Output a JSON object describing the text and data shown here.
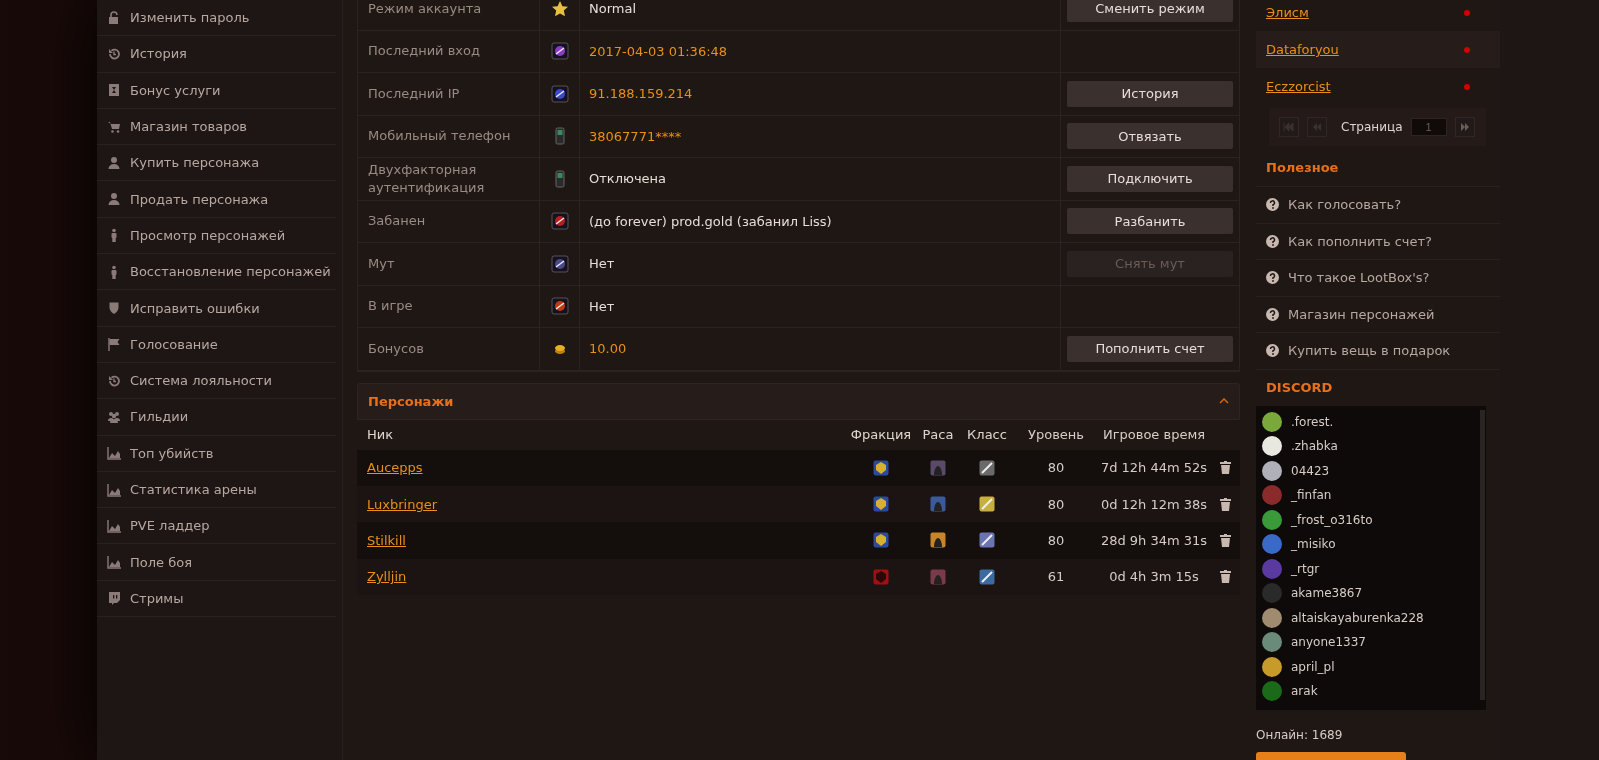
{
  "sidebar": {
    "items": [
      {
        "label": "Изменить пароль"
      },
      {
        "label": "История"
      },
      {
        "label": "Бонус услуги"
      },
      {
        "label": "Магазин товаров"
      },
      {
        "label": "Купить персонажа"
      },
      {
        "label": "Продать персонажа"
      },
      {
        "label": "Просмотр персонажей"
      },
      {
        "label": "Восстановление персонажей"
      },
      {
        "label": "Исправить ошибки"
      },
      {
        "label": "Голосование"
      },
      {
        "label": "Система лояльности"
      },
      {
        "label": "Гильдии"
      },
      {
        "label": "Топ убийств"
      },
      {
        "label": "Статистика арены"
      },
      {
        "label": "PVE ладдер"
      },
      {
        "label": "Поле боя"
      },
      {
        "label": "Стримы"
      }
    ]
  },
  "account": {
    "rows": [
      {
        "label": "Режим аккаунта",
        "value": "Normal",
        "accent": false,
        "action": {
          "label": "Сменить режим",
          "disabled": false
        }
      },
      {
        "label": "Последний вход",
        "value": "2017-04-03 01:36:48",
        "accent": true
      },
      {
        "label": "Последний IP",
        "value": "91.188.159.214",
        "accent": true,
        "action": {
          "label": "История",
          "disabled": false
        }
      },
      {
        "label": "Мобильный телефон",
        "value": "38067771****",
        "accent": true,
        "action": {
          "label": "Отвязать",
          "disabled": false
        }
      },
      {
        "label": "Двухфакторная аутентификация",
        "value": "Отключена",
        "accent": false,
        "action": {
          "label": "Подключить",
          "disabled": false
        }
      },
      {
        "label": "Забанен",
        "value": "(до forever) prod.gold (забанил Liss)",
        "accent": false,
        "action": {
          "label": "Разбанить",
          "disabled": false
        }
      },
      {
        "label": "Мут",
        "value": "Нет",
        "accent": false,
        "action": {
          "label": "Снять мут",
          "disabled": true
        }
      },
      {
        "label": "В игре",
        "value": "Нет",
        "accent": false
      },
      {
        "label": "Бонусов",
        "value": "10.00",
        "accent": true,
        "action": {
          "label": "Пополнить счет",
          "disabled": false
        }
      }
    ]
  },
  "characters": {
    "title": "Персонажи",
    "expanded": true,
    "columns": [
      "Ник",
      "Фракция",
      "Раса",
      "Класс",
      "Уровень",
      "Игровое время"
    ],
    "rows": [
      {
        "name": "Aucepps",
        "kind": "alliance",
        "level": "80",
        "time": "7d 12h 44m 52s"
      },
      {
        "name": "Luxbringer",
        "kind": "alliance",
        "level": "80",
        "time": "0d 12h 12m 38s"
      },
      {
        "name": "Stilkill",
        "kind": "alliance",
        "level": "80",
        "time": "28d 9h 34m 31s"
      },
      {
        "name": "Zylljin",
        "kind": "horde",
        "level": "61",
        "time": "0d 4h 3m 15s"
      }
    ]
  },
  "friends": [
    {
      "name": "Элисм",
      "online": false
    },
    {
      "name": "Dataforyou",
      "online": false
    },
    {
      "name": "Eczzorcist",
      "online": false
    }
  ],
  "pager": {
    "label": "Страница",
    "placeholder": "1"
  },
  "useful": {
    "title": "Полезное",
    "items": [
      "Как голосовать?",
      "Как пополнить счет?",
      "Что такое LootBox's?",
      "Магазин персонажей",
      "Купить вещь в подарок"
    ]
  },
  "discord": {
    "title": "DISCORD",
    "members": [
      {
        "name": ".forest."
      },
      {
        "name": ".zhabka"
      },
      {
        "name": "04423"
      },
      {
        "name": "_finfan"
      },
      {
        "name": "_frost_o316to"
      },
      {
        "name": "_misiko"
      },
      {
        "name": "_rtgr"
      },
      {
        "name": "akame3867"
      },
      {
        "name": "altaiskayaburenka228"
      },
      {
        "name": "anyone1337"
      },
      {
        "name": "april_pl"
      },
      {
        "name": "arak"
      }
    ],
    "online": "Онлайн: 1689"
  }
}
